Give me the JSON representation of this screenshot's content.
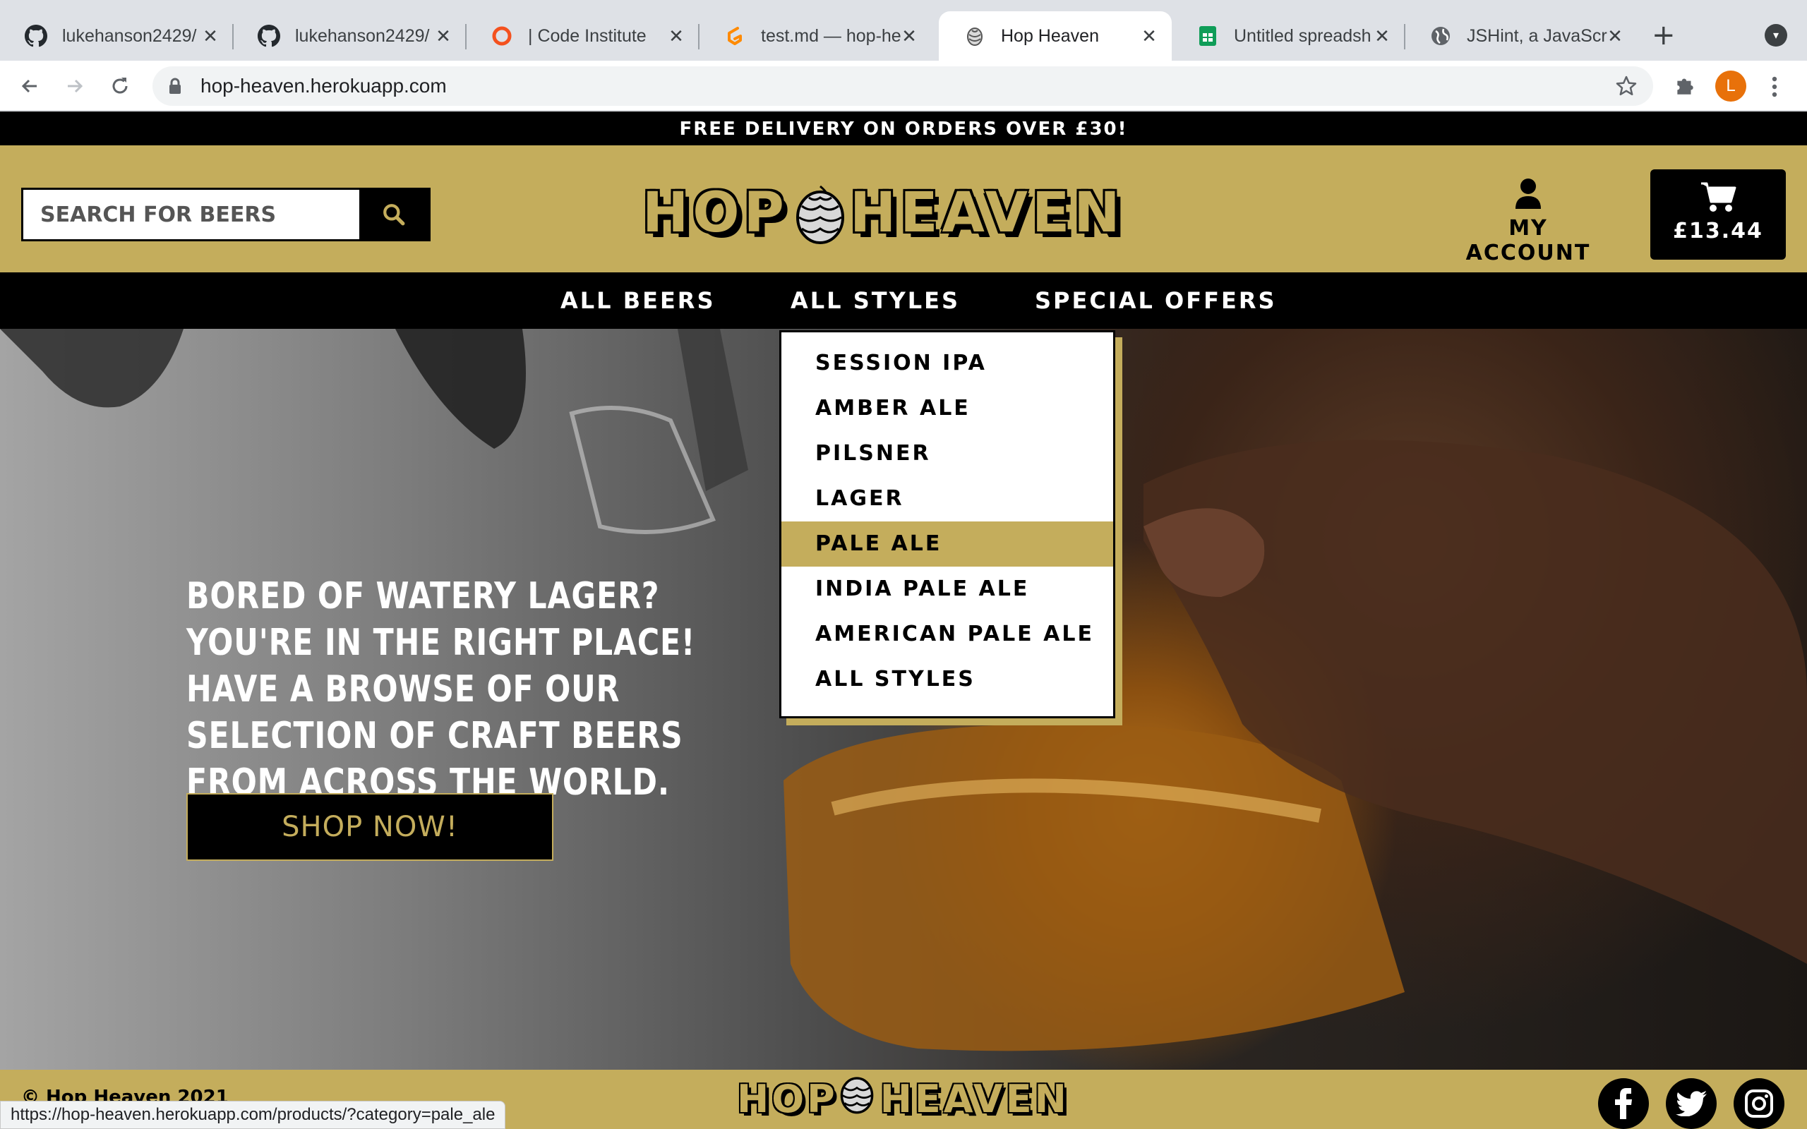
{
  "browser": {
    "tabs": [
      {
        "title": "lukehanson2429/",
        "icon": "github-icon"
      },
      {
        "title": "lukehanson2429/",
        "icon": "github-icon"
      },
      {
        "title": "| Code Institute",
        "icon": "code-institute-icon"
      },
      {
        "title": "test.md — hop-he",
        "icon": "gitpod-icon"
      },
      {
        "title": "Hop Heaven",
        "icon": "hop-icon",
        "active": true
      },
      {
        "title": "Untitled spreadsh",
        "icon": "sheets-icon"
      },
      {
        "title": "JSHint, a JavaScr",
        "icon": "globe-icon"
      }
    ],
    "url": "hop-heaven.herokuapp.com",
    "profile_initial": "L",
    "status_url": "https://hop-heaven.herokuapp.com/products/?category=pale_ale"
  },
  "site": {
    "promo": "FREE DELIVERY ON ORDERS OVER £30!",
    "search_placeholder": "SEARCH FOR BEERS",
    "logo_left": "HOP",
    "logo_right": "HEAVEN",
    "account_label": "MY ACCOUNT",
    "cart_total": "£13.44",
    "nav": [
      "ALL BEERS",
      "ALL STYLES",
      "SPECIAL OFFERS"
    ],
    "dropdown": [
      "SESSION IPA",
      "AMBER ALE",
      "PILSNER",
      "LAGER",
      "PALE ALE",
      "INDIA PALE ALE",
      "AMERICAN PALE ALE",
      "ALL STYLES"
    ],
    "dropdown_active": "PALE ALE",
    "hero_text": "BORED OF WATERY LAGER? YOU'RE IN THE RIGHT PLACE! HAVE A BROWSE OF OUR SELECTION OF CRAFT BEERS FROM ACROSS THE WORLD.",
    "shop_button": "SHOP NOW!",
    "footer_copyright": "© Hop Heaven 2021",
    "colors": {
      "brand_gold": "#c4ad5c",
      "black": "#000000"
    }
  }
}
